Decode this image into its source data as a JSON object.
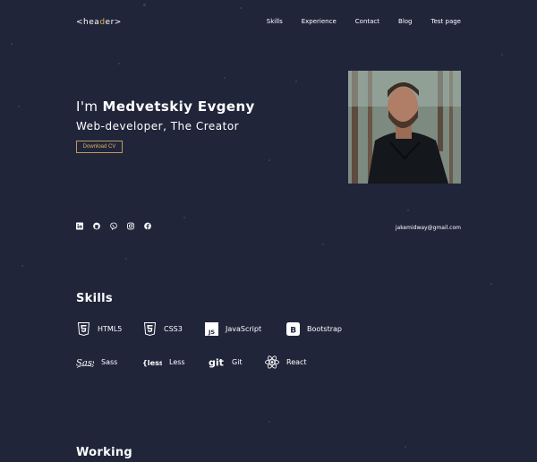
{
  "header": {
    "logo_open": "<",
    "logo_head": "hea",
    "logo_accent": "d",
    "logo_tail": "er",
    "logo_close": ">",
    "nav": [
      "Skills",
      "Experience",
      "Contact",
      "Blog",
      "Test page"
    ]
  },
  "hero": {
    "title_prefix": "I'm",
    "name": "Medvetskiy Evgeny",
    "subtitle": "Web-developer, The Creator",
    "cv_button": "Download CV",
    "photo_icon": "profile-photo"
  },
  "socials": {
    "icons": [
      "linkedin-icon",
      "github-icon",
      "viber-icon",
      "instagram-icon",
      "facebook-icon"
    ],
    "email": "jakemidway@gmail.com"
  },
  "skills": {
    "title": "Skills",
    "items": [
      {
        "label": "HTML5",
        "icon": "html5-icon"
      },
      {
        "label": "CSS3",
        "icon": "css3-icon"
      },
      {
        "label": "JavaScript",
        "icon": "javascript-icon"
      },
      {
        "label": "Bootstrap",
        "icon": "bootstrap-icon"
      },
      {
        "label": "Sass",
        "icon": "sass-icon"
      },
      {
        "label": "Less",
        "icon": "less-icon"
      },
      {
        "label": "Git",
        "icon": "git-icon"
      },
      {
        "label": "React",
        "icon": "react-icon"
      }
    ]
  },
  "working": {
    "title": "Working"
  },
  "colors": {
    "background": "#20253a",
    "accent": "#e0b05a",
    "text": "#ffffff"
  }
}
